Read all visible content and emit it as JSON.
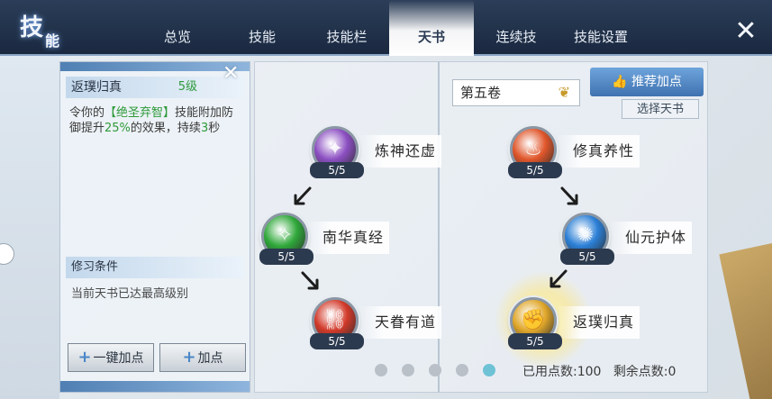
{
  "header": {
    "logo_text": "技",
    "logo_small": "能",
    "tabs": [
      {
        "label": "总览"
      },
      {
        "label": "技能"
      },
      {
        "label": "技能栏"
      },
      {
        "label": "天书",
        "active": true
      },
      {
        "label": "连续技"
      },
      {
        "label": "技能设置"
      }
    ],
    "close_glyph": "✕"
  },
  "detail": {
    "skill_name": "返璞归真",
    "skill_level": "5级",
    "desc_1": "令你的",
    "desc_skill": "【绝圣弃智】",
    "desc_2": "技能附加防御提升",
    "desc_pct": "25%",
    "desc_3": "的效果，持续",
    "desc_sec": "3",
    "desc_4": "秒",
    "cond_title": "修习条件",
    "cond_text": "当前天书已达最高级别",
    "btn_all": "一键加点",
    "btn_add": "加点",
    "close_glyph": "✕"
  },
  "tree": {
    "book": "第五卷",
    "recommend": "推荐加点",
    "choose": "选择天书",
    "nodes": [
      {
        "name": "炼神还虚",
        "count": "5/5",
        "color": "#8c4fc2",
        "icon": "crystal-icon"
      },
      {
        "name": "南华真经",
        "count": "5/5",
        "color": "#2fa83a",
        "icon": "leaf-icon"
      },
      {
        "name": "天眷有道",
        "count": "5/5",
        "color": "#d23a2a",
        "icon": "chain-icon"
      },
      {
        "name": "修真养性",
        "count": "5/5",
        "color": "#e0562a",
        "icon": "flame-icon"
      },
      {
        "name": "仙元护体",
        "count": "5/5",
        "color": "#2b7fd6",
        "icon": "shield-icon"
      },
      {
        "name": "返璞归真",
        "count": "5/5",
        "color": "#e0a72a",
        "icon": "fist-icon"
      }
    ],
    "points_used_label": "已用点数:",
    "points_used": "100",
    "points_left_label": "剩余点数:",
    "points_left": "0",
    "pages": 5,
    "active_page": 5
  }
}
